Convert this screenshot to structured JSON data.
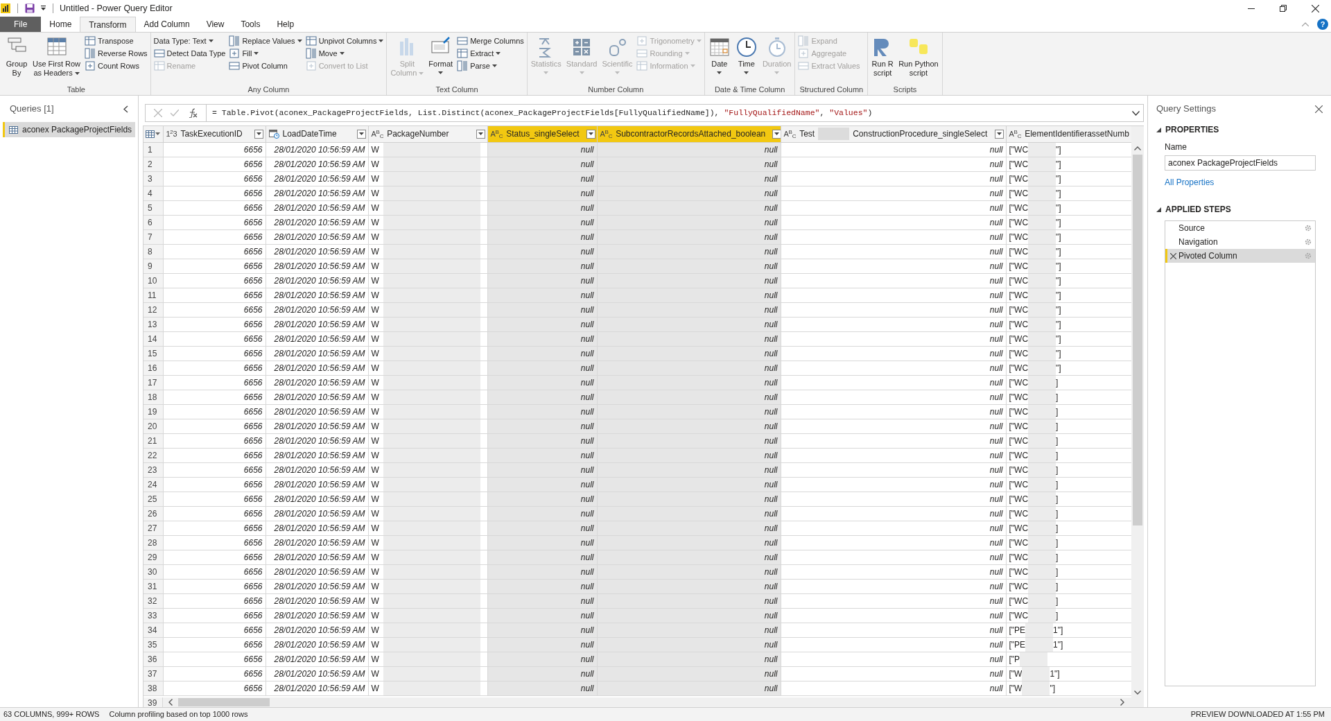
{
  "window": {
    "title": "Untitled - Power Query Editor"
  },
  "menu_tabs": [
    {
      "label": "File",
      "kind": "file",
      "selected": false
    },
    {
      "label": "Home",
      "kind": "tab",
      "selected": false
    },
    {
      "label": "Transform",
      "kind": "tab",
      "selected": true
    },
    {
      "label": "Add Column",
      "kind": "tab",
      "selected": false
    },
    {
      "label": "View",
      "kind": "tab",
      "selected": false
    },
    {
      "label": "Tools",
      "kind": "tab",
      "selected": false
    },
    {
      "label": "Help",
      "kind": "tab",
      "selected": false
    }
  ],
  "help": "?",
  "ribbon_groups": [
    {
      "label": "Table",
      "blocks": [
        {
          "kind": "large",
          "items": [
            {
              "lines": [
                "Group",
                "By"
              ],
              "disabled": false,
              "dropdown": false
            }
          ]
        },
        {
          "kind": "large",
          "items": [
            {
              "lines": [
                "Use First Row",
                "as Headers"
              ],
              "disabled": false,
              "dropdown": true
            }
          ]
        },
        {
          "kind": "small",
          "items": [
            {
              "lines": [
                "Transpose"
              ],
              "disabled": false,
              "dropdown": false
            },
            {
              "lines": [
                "Reverse Rows"
              ],
              "disabled": false,
              "dropdown": false
            },
            {
              "lines": [
                "Count Rows"
              ],
              "disabled": false,
              "dropdown": false
            }
          ]
        }
      ]
    },
    {
      "label": "Any Column",
      "blocks": [
        {
          "kind": "small",
          "items": [
            {
              "lines": [
                "Data Type: Text"
              ],
              "disabled": false,
              "dropdown": true,
              "noicon": true
            },
            {
              "lines": [
                "Detect Data Type"
              ],
              "disabled": false,
              "dropdown": false
            },
            {
              "lines": [
                "Rename"
              ],
              "disabled": true,
              "dropdown": false
            }
          ]
        },
        {
          "kind": "small",
          "items": [
            {
              "lines": [
                "Replace Values"
              ],
              "disabled": false,
              "dropdown": true
            },
            {
              "lines": [
                "Fill"
              ],
              "disabled": false,
              "dropdown": true
            },
            {
              "lines": [
                "Pivot Column"
              ],
              "disabled": false,
              "dropdown": false
            }
          ]
        },
        {
          "kind": "small",
          "items": [
            {
              "lines": [
                "Unpivot Columns"
              ],
              "disabled": false,
              "dropdown": true
            },
            {
              "lines": [
                "Move"
              ],
              "disabled": false,
              "dropdown": true
            },
            {
              "lines": [
                "Convert to List"
              ],
              "disabled": true,
              "dropdown": false
            }
          ]
        }
      ]
    },
    {
      "label": "Text Column",
      "blocks": [
        {
          "kind": "large",
          "items": [
            {
              "lines": [
                "Split",
                "Column"
              ],
              "disabled": true,
              "dropdown": true
            }
          ]
        },
        {
          "kind": "large",
          "items": [
            {
              "lines": [
                "Format"
              ],
              "disabled": false,
              "dropdown": true
            }
          ]
        },
        {
          "kind": "small",
          "items": [
            {
              "lines": [
                "Merge Columns"
              ],
              "disabled": false,
              "dropdown": false
            },
            {
              "lines": [
                "Extract"
              ],
              "disabled": false,
              "dropdown": true
            },
            {
              "lines": [
                "Parse"
              ],
              "disabled": false,
              "dropdown": true
            }
          ]
        }
      ]
    },
    {
      "label": "Number Column",
      "blocks": [
        {
          "kind": "large",
          "items": [
            {
              "lines": [
                "Statistics"
              ],
              "disabled": true,
              "dropdown": true
            }
          ]
        },
        {
          "kind": "large",
          "items": [
            {
              "lines": [
                "Standard"
              ],
              "disabled": true,
              "dropdown": true
            }
          ]
        },
        {
          "kind": "large",
          "items": [
            {
              "lines": [
                "Scientific"
              ],
              "disabled": true,
              "dropdown": true
            }
          ]
        },
        {
          "kind": "small",
          "items": [
            {
              "lines": [
                "Trigonometry"
              ],
              "disabled": true,
              "dropdown": true
            },
            {
              "lines": [
                "Rounding"
              ],
              "disabled": true,
              "dropdown": true
            },
            {
              "lines": [
                "Information"
              ],
              "disabled": true,
              "dropdown": true
            }
          ]
        }
      ]
    },
    {
      "label": "Date & Time Column",
      "blocks": [
        {
          "kind": "large",
          "items": [
            {
              "lines": [
                "Date"
              ],
              "disabled": false,
              "dropdown": true
            }
          ]
        },
        {
          "kind": "large",
          "items": [
            {
              "lines": [
                "Time"
              ],
              "disabled": false,
              "dropdown": true
            }
          ]
        },
        {
          "kind": "large",
          "items": [
            {
              "lines": [
                "Duration"
              ],
              "disabled": true,
              "dropdown": true
            }
          ]
        }
      ]
    },
    {
      "label": "Structured Column",
      "blocks": [
        {
          "kind": "small",
          "items": [
            {
              "lines": [
                "Expand"
              ],
              "disabled": true,
              "dropdown": false
            },
            {
              "lines": [
                "Aggregate"
              ],
              "disabled": true,
              "dropdown": false
            },
            {
              "lines": [
                "Extract Values"
              ],
              "disabled": true,
              "dropdown": false
            }
          ]
        }
      ]
    },
    {
      "label": "Scripts",
      "blocks": [
        {
          "kind": "large",
          "items": [
            {
              "lines": [
                "Run R",
                "script"
              ],
              "disabled": false,
              "dropdown": false
            }
          ]
        },
        {
          "kind": "large",
          "items": [
            {
              "lines": [
                "Run Python",
                "script"
              ],
              "disabled": false,
              "dropdown": false
            }
          ]
        }
      ]
    }
  ],
  "queries": {
    "title": "Queries [1]",
    "items": [
      {
        "label": "aconex PackageProjectFields",
        "selected": true
      }
    ]
  },
  "formula": [
    {
      "text": "= Table.Pivot(aconex_PackageProjectFields, List.Distinct(aconex_PackageProjectFields[FullyQualifiedName]), ",
      "kind": "code"
    },
    {
      "text": "\"FullyQualifiedName\"",
      "kind": "string"
    },
    {
      "text": ", ",
      "kind": "code"
    },
    {
      "text": "\"Values\"",
      "kind": "string"
    },
    {
      "text": ")",
      "kind": "code"
    }
  ],
  "columns": [
    {
      "label": "TaskExecutionID",
      "kind": "number",
      "type_label": "1$^{2}$3",
      "selected": false
    },
    {
      "label": "LoadDateTime",
      "kind": "datetime",
      "selected": false
    },
    {
      "label": "PackageNumber",
      "kind": "text",
      "type_label": "A$^{B}$$_{C}$",
      "selected": false
    },
    {
      "label": "Status_singleSelect",
      "kind": "text",
      "type_label": "A$^{B}$$_{C}$",
      "selected": true
    },
    {
      "label": "SubcontractorRecordsAttached_boolean",
      "kind": "text",
      "type_label": "A$^{B}$$_{C}$",
      "selected": true
    },
    {
      "label": "Test",
      "label_end": "ConstructionProcedure_singleSelect",
      "kind": "text",
      "type_label": "A$^{B}$$_{C}$",
      "selected": false
    },
    {
      "label": "ElementIdentifierassetNumb",
      "kind": "text",
      "type_label": "A$^{B}$$_{C}$",
      "selected": false
    }
  ],
  "rows": [
    {
      "number": "1",
      "task": "6656",
      "load": "28/01/2020 10:56:59 AM",
      "package": "W",
      "status": "null",
      "subcontractor": "null",
      "procedure": "null",
      "element_start": "[\"WC",
      "element_end": "\"]"
    },
    {
      "number": "2",
      "task": "6656",
      "load": "28/01/2020 10:56:59 AM",
      "package": "W",
      "status": "null",
      "subcontractor": "null",
      "procedure": "null",
      "element_start": "[\"WC",
      "element_end": "\"]"
    },
    {
      "number": "3",
      "task": "6656",
      "load": "28/01/2020 10:56:59 AM",
      "package": "W",
      "status": "null",
      "subcontractor": "null",
      "procedure": "null",
      "element_start": "[\"WC",
      "element_end": "\"]"
    },
    {
      "number": "4",
      "task": "6656",
      "load": "28/01/2020 10:56:59 AM",
      "package": "W",
      "status": "null",
      "subcontractor": "null",
      "procedure": "null",
      "element_start": "[\"WC",
      "element_end": "\"]"
    },
    {
      "number": "5",
      "task": "6656",
      "load": "28/01/2020 10:56:59 AM",
      "package": "W",
      "status": "null",
      "subcontractor": "null",
      "procedure": "null",
      "element_start": "[\"WC",
      "element_end": "\"]"
    },
    {
      "number": "6",
      "task": "6656",
      "load": "28/01/2020 10:56:59 AM",
      "package": "W",
      "status": "null",
      "subcontractor": "null",
      "procedure": "null",
      "element_start": "[\"WC",
      "element_end": "\"]"
    },
    {
      "number": "7",
      "task": "6656",
      "load": "28/01/2020 10:56:59 AM",
      "package": "W",
      "status": "null",
      "subcontractor": "null",
      "procedure": "null",
      "element_start": "[\"WC",
      "element_end": "\"]"
    },
    {
      "number": "8",
      "task": "6656",
      "load": "28/01/2020 10:56:59 AM",
      "package": "W",
      "status": "null",
      "subcontractor": "null",
      "procedure": "null",
      "element_start": "[\"WC",
      "element_end": "\"]"
    },
    {
      "number": "9",
      "task": "6656",
      "load": "28/01/2020 10:56:59 AM",
      "package": "W",
      "status": "null",
      "subcontractor": "null",
      "procedure": "null",
      "element_start": "[\"WC",
      "element_end": "\"]"
    },
    {
      "number": "10",
      "task": "6656",
      "load": "28/01/2020 10:56:59 AM",
      "package": "W",
      "status": "null",
      "subcontractor": "null",
      "procedure": "null",
      "element_start": "[\"WC",
      "element_end": "\"]"
    },
    {
      "number": "11",
      "task": "6656",
      "load": "28/01/2020 10:56:59 AM",
      "package": "W",
      "status": "null",
      "subcontractor": "null",
      "procedure": "null",
      "element_start": "[\"WC",
      "element_end": "\"]"
    },
    {
      "number": "12",
      "task": "6656",
      "load": "28/01/2020 10:56:59 AM",
      "package": "W",
      "status": "null",
      "subcontractor": "null",
      "procedure": "null",
      "element_start": "[\"WC",
      "element_end": "\"]"
    },
    {
      "number": "13",
      "task": "6656",
      "load": "28/01/2020 10:56:59 AM",
      "package": "W",
      "status": "null",
      "subcontractor": "null",
      "procedure": "null",
      "element_start": "[\"WC",
      "element_end": "\"]"
    },
    {
      "number": "14",
      "task": "6656",
      "load": "28/01/2020 10:56:59 AM",
      "package": "W",
      "status": "null",
      "subcontractor": "null",
      "procedure": "null",
      "element_start": "[\"WC",
      "element_end": "\"]"
    },
    {
      "number": "15",
      "task": "6656",
      "load": "28/01/2020 10:56:59 AM",
      "package": "W",
      "status": "null",
      "subcontractor": "null",
      "procedure": "null",
      "element_start": "[\"WC",
      "element_end": "\"]"
    },
    {
      "number": "16",
      "task": "6656",
      "load": "28/01/2020 10:56:59 AM",
      "package": "W",
      "status": "null",
      "subcontractor": "null",
      "procedure": "null",
      "element_start": "[\"WC",
      "element_end": "\"]"
    },
    {
      "number": "17",
      "task": "6656",
      "load": "28/01/2020 10:56:59 AM",
      "package": "W",
      "status": "null",
      "subcontractor": "null",
      "procedure": "null",
      "element_start": "[\"WC",
      "element_end": "]"
    },
    {
      "number": "18",
      "task": "6656",
      "load": "28/01/2020 10:56:59 AM",
      "package": "W",
      "status": "null",
      "subcontractor": "null",
      "procedure": "null",
      "element_start": "[\"WC",
      "element_end": "]"
    },
    {
      "number": "19",
      "task": "6656",
      "load": "28/01/2020 10:56:59 AM",
      "package": "W",
      "status": "null",
      "subcontractor": "null",
      "procedure": "null",
      "element_start": "[\"WC",
      "element_end": "]"
    },
    {
      "number": "20",
      "task": "6656",
      "load": "28/01/2020 10:56:59 AM",
      "package": "W",
      "status": "null",
      "subcontractor": "null",
      "procedure": "null",
      "element_start": "[\"WC",
      "element_end": "]"
    },
    {
      "number": "21",
      "task": "6656",
      "load": "28/01/2020 10:56:59 AM",
      "package": "W",
      "status": "null",
      "subcontractor": "null",
      "procedure": "null",
      "element_start": "[\"WC",
      "element_end": "]"
    },
    {
      "number": "22",
      "task": "6656",
      "load": "28/01/2020 10:56:59 AM",
      "package": "W",
      "status": "null",
      "subcontractor": "null",
      "procedure": "null",
      "element_start": "[\"WC",
      "element_end": "]"
    },
    {
      "number": "23",
      "task": "6656",
      "load": "28/01/2020 10:56:59 AM",
      "package": "W",
      "status": "null",
      "subcontractor": "null",
      "procedure": "null",
      "element_start": "[\"WC",
      "element_end": "]"
    },
    {
      "number": "24",
      "task": "6656",
      "load": "28/01/2020 10:56:59 AM",
      "package": "W",
      "status": "null",
      "subcontractor": "null",
      "procedure": "null",
      "element_start": "[\"WC",
      "element_end": "]"
    },
    {
      "number": "25",
      "task": "6656",
      "load": "28/01/2020 10:56:59 AM",
      "package": "W",
      "status": "null",
      "subcontractor": "null",
      "procedure": "null",
      "element_start": "[\"WC",
      "element_end": "]"
    },
    {
      "number": "26",
      "task": "6656",
      "load": "28/01/2020 10:56:59 AM",
      "package": "W",
      "status": "null",
      "subcontractor": "null",
      "procedure": "null",
      "element_start": "[\"WC",
      "element_end": "]"
    },
    {
      "number": "27",
      "task": "6656",
      "load": "28/01/2020 10:56:59 AM",
      "package": "W",
      "status": "null",
      "subcontractor": "null",
      "procedure": "null",
      "element_start": "[\"WC",
      "element_end": "]"
    },
    {
      "number": "28",
      "task": "6656",
      "load": "28/01/2020 10:56:59 AM",
      "package": "W",
      "status": "null",
      "subcontractor": "null",
      "procedure": "null",
      "element_start": "[\"WC",
      "element_end": "]"
    },
    {
      "number": "29",
      "task": "6656",
      "load": "28/01/2020 10:56:59 AM",
      "package": "W",
      "status": "null",
      "subcontractor": "null",
      "procedure": "null",
      "element_start": "[\"WC",
      "element_end": "]"
    },
    {
      "number": "30",
      "task": "6656",
      "load": "28/01/2020 10:56:59 AM",
      "package": "W",
      "status": "null",
      "subcontractor": "null",
      "procedure": "null",
      "element_start": "[\"WC",
      "element_end": "]"
    },
    {
      "number": "31",
      "task": "6656",
      "load": "28/01/2020 10:56:59 AM",
      "package": "W",
      "status": "null",
      "subcontractor": "null",
      "procedure": "null",
      "element_start": "[\"WC",
      "element_end": "]"
    },
    {
      "number": "32",
      "task": "6656",
      "load": "28/01/2020 10:56:59 AM",
      "package": "W",
      "status": "null",
      "subcontractor": "null",
      "procedure": "null",
      "element_start": "[\"WC",
      "element_end": "]"
    },
    {
      "number": "33",
      "task": "6656",
      "load": "28/01/2020 10:56:59 AM",
      "package": "W",
      "status": "null",
      "subcontractor": "null",
      "procedure": "null",
      "element_start": "[\"WC",
      "element_end": "]"
    },
    {
      "number": "34",
      "task": "6656",
      "load": "28/01/2020 10:56:59 AM",
      "package": "W",
      "status": "null",
      "subcontractor": "null",
      "procedure": "null",
      "element_start": "[\"PE",
      "element_end": "1\"]"
    },
    {
      "number": "35",
      "task": "6656",
      "load": "28/01/2020 10:56:59 AM",
      "package": "W",
      "status": "null",
      "subcontractor": "null",
      "procedure": "null",
      "element_start": "[\"PE",
      "element_end": "1\"]"
    },
    {
      "number": "36",
      "task": "6656",
      "load": "28/01/2020 10:56:59 AM",
      "package": "W",
      "status": "null",
      "subcontractor": "null",
      "procedure": "null",
      "element_start": "[\"P"
    },
    {
      "number": "37",
      "task": "6656",
      "load": "28/01/2020 10:56:59 AM",
      "package": "W",
      "status": "null",
      "subcontractor": "null",
      "procedure": "null",
      "element_start": "[\"W",
      "element_end": "1\"]"
    },
    {
      "number": "38",
      "task": "6656",
      "load": "28/01/2020 10:56:59 AM",
      "package": "W",
      "status": "null",
      "subcontractor": "null",
      "procedure": "null",
      "element_start": "[\"W",
      "element_end": "\"]"
    }
  ],
  "partial_row_number": "39",
  "settings": {
    "title": "Query Settings",
    "properties_heading": "PROPERTIES",
    "name_label": "Name",
    "name_value": "aconex PackageProjectFields",
    "all_properties": "All Properties",
    "steps_heading": "APPLIED STEPS",
    "steps": [
      {
        "label": "Source",
        "selected": false
      },
      {
        "label": "Navigation",
        "selected": false
      },
      {
        "label": "Pivoted Column",
        "selected": true
      }
    ]
  },
  "status_bar": {
    "counts": "63 COLUMNS, 999+ ROWS",
    "profiling": "Column profiling based on top 1000 rows",
    "preview": "PREVIEW DOWNLOADED AT 1:55 PM"
  }
}
